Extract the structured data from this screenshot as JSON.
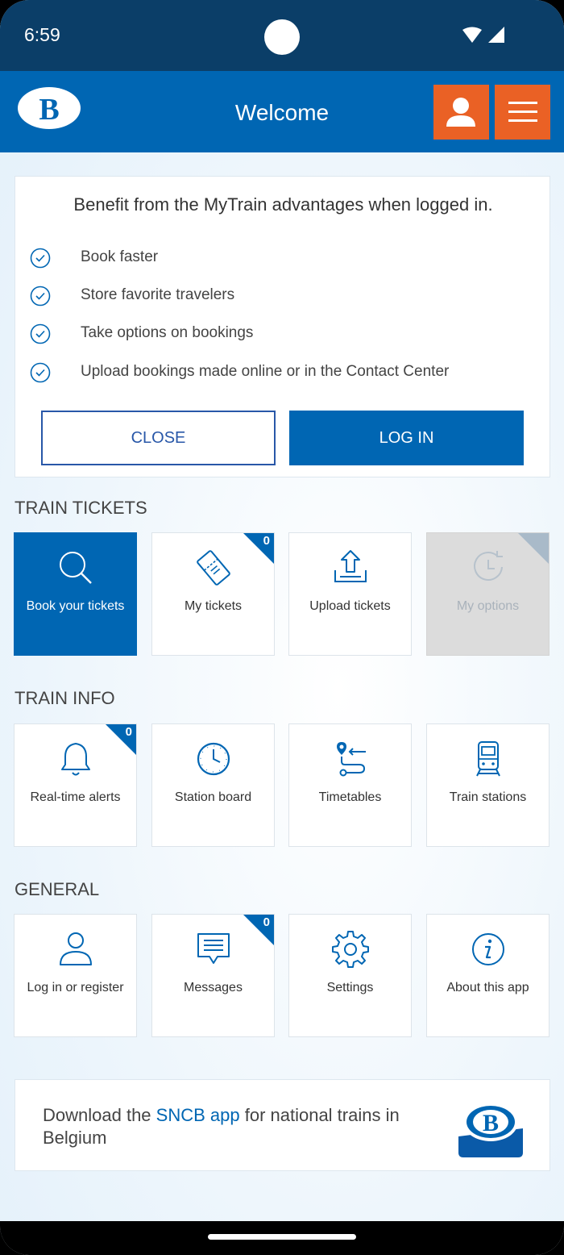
{
  "status": {
    "time": "6:59"
  },
  "header": {
    "title": "Welcome",
    "logo_letter": "B"
  },
  "promo": {
    "title": "Benefit from the MyTrain advantages when logged in.",
    "benefits": [
      "Book faster",
      "Store favorite travelers",
      "Take options on bookings",
      "Upload bookings made online or in the Contact Center"
    ],
    "close_label": "CLOSE",
    "login_label": "LOG IN"
  },
  "sections": {
    "tickets": {
      "title": "TRAIN TICKETS",
      "tiles": [
        {
          "label": "Book your tickets",
          "icon": "search-icon"
        },
        {
          "label": "My tickets",
          "icon": "ticket-icon",
          "badge": "0"
        },
        {
          "label": "Upload tickets",
          "icon": "upload-icon"
        },
        {
          "label": "My options",
          "icon": "clock-icon"
        }
      ]
    },
    "info": {
      "title": "TRAIN INFO",
      "tiles": [
        {
          "label": "Real-time alerts",
          "icon": "bell-icon",
          "badge": "0"
        },
        {
          "label": "Station board",
          "icon": "clock-icon"
        },
        {
          "label": "Timetables",
          "icon": "route-icon"
        },
        {
          "label": "Train stations",
          "icon": "train-icon"
        }
      ]
    },
    "general": {
      "title": "GENERAL",
      "tiles": [
        {
          "label": "Log in or register",
          "icon": "user-icon"
        },
        {
          "label": "Messages",
          "icon": "message-icon",
          "badge": "0"
        },
        {
          "label": "Settings",
          "icon": "gear-icon"
        },
        {
          "label": "About this app",
          "icon": "info-icon"
        }
      ]
    }
  },
  "download": {
    "prefix": "Download the ",
    "link": "SNCB app",
    "suffix": " for national trains in Belgium",
    "logo_letter": "B"
  },
  "colors": {
    "primary": "#0066b3",
    "accent": "#ea6125",
    "status_bar": "#0b3e68"
  }
}
